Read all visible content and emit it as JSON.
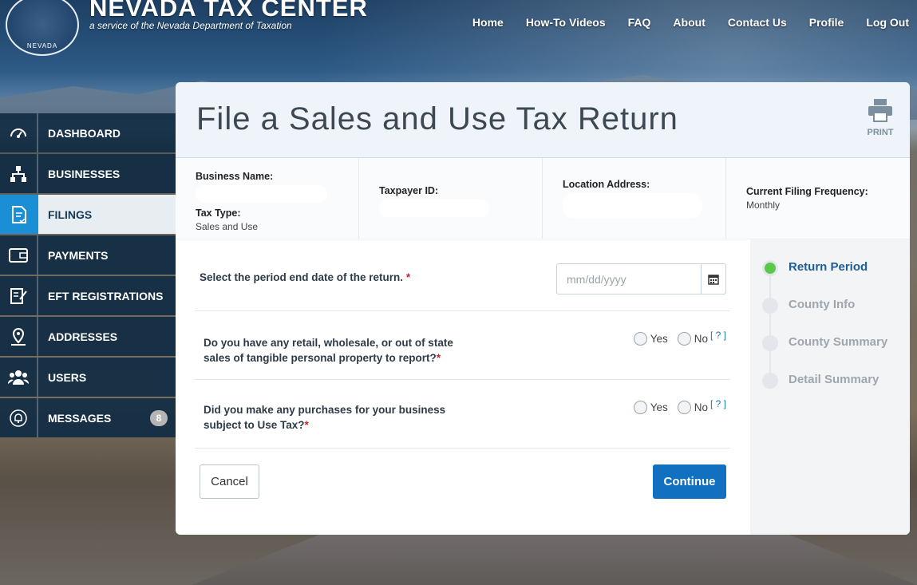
{
  "header": {
    "title": "NEVADA TAX CENTER",
    "subtitle": "a service of the Nevada Department of Taxation",
    "seal_text": "NEVADA"
  },
  "topnav": [
    "Home",
    "How-To Videos",
    "FAQ",
    "About",
    "Contact Us",
    "Profile",
    "Log Out"
  ],
  "sidebar": {
    "items": [
      {
        "label": "DASHBOARD",
        "icon": "gauge-icon"
      },
      {
        "label": "BUSINESSES",
        "icon": "org-chart-icon"
      },
      {
        "label": "FILINGS",
        "icon": "document-check-icon"
      },
      {
        "label": "PAYMENTS",
        "icon": "wallet-icon"
      },
      {
        "label": "EFT REGISTRATIONS",
        "icon": "edit-document-icon"
      },
      {
        "label": "ADDRESSES",
        "icon": "map-pin-icon"
      },
      {
        "label": "USERS",
        "icon": "users-icon"
      },
      {
        "label": "MESSAGES",
        "icon": "bell-icon"
      }
    ],
    "active": "FILINGS",
    "messages_badge": "8"
  },
  "page": {
    "title": "File a Sales and Use Tax Return",
    "print_label": "PRINT"
  },
  "info": {
    "business_name_label": "Business Name:",
    "tax_type_label": "Tax Type:",
    "tax_type_value": "Sales and Use",
    "taxpayer_id_label": "Taxpayer ID:",
    "location_label": "Location Address:",
    "frequency_label": "Current Filing Frequency:",
    "frequency_value": "Monthly"
  },
  "form": {
    "q1": "Select the period end date of the return.",
    "date_placeholder": "mm/dd/yyyy",
    "q2_line1": "Do you have any retail, wholesale, or out of state",
    "q2_line2": "sales of tangible personal property to report?",
    "q3_line1": "Did you make any purchases for your business",
    "q3_line2": "subject to Use Tax?",
    "required": "*",
    "yes": "Yes",
    "no": "No",
    "help": "[ ? ]",
    "cancel": "Cancel",
    "continue": "Continue"
  },
  "steps": [
    "Return Period",
    "County Info",
    "County Summary",
    "Detail Summary"
  ],
  "colors": {
    "accent": "#1170c0",
    "active_step": "#5cc84a",
    "sidebar_bg": "#102b43"
  }
}
